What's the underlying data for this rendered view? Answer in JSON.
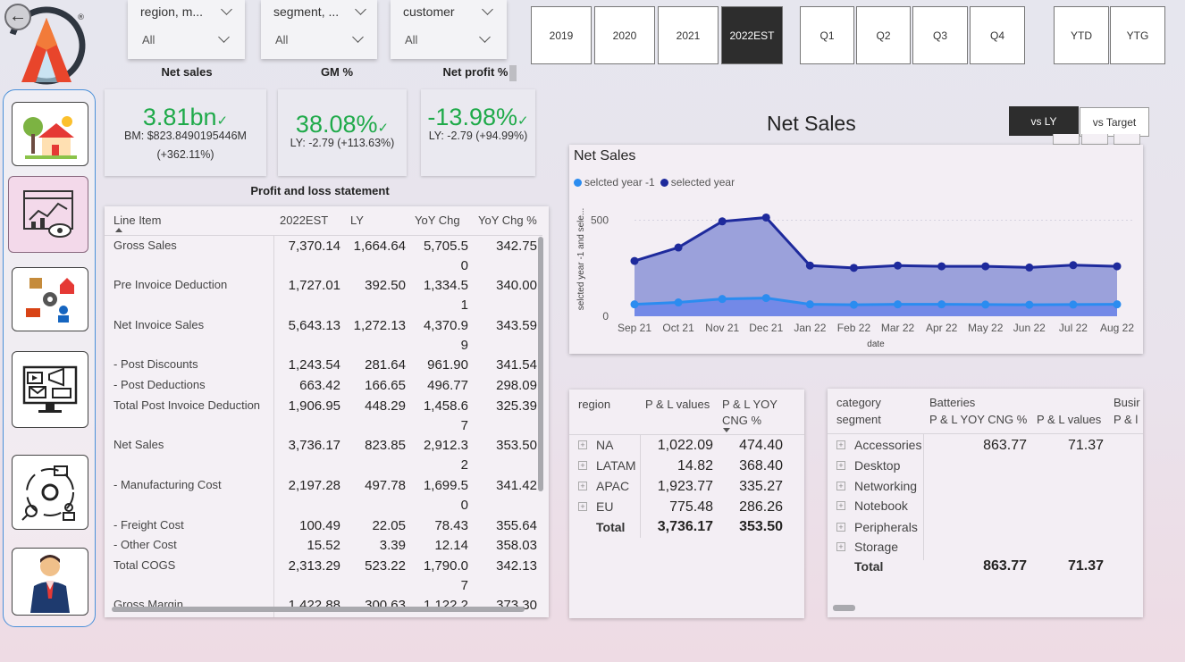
{
  "slicers": [
    {
      "title": "region, m...",
      "value": "All"
    },
    {
      "title": "segment, ...",
      "value": "All"
    },
    {
      "title": "customer",
      "value": "All"
    }
  ],
  "years": [
    "2019",
    "2020",
    "2021",
    "2022EST"
  ],
  "selected_year": "2022EST",
  "quarters": [
    "Q1",
    "Q2",
    "Q3",
    "Q4"
  ],
  "period_buttons": [
    "YTD",
    "YTG"
  ],
  "kpis": {
    "net_sales": {
      "title": "Net sales",
      "value": "3.81bn",
      "line1": "BM: $823.8490195446M",
      "line2": "(+362.11%)"
    },
    "gm": {
      "title": "GM %",
      "value": "38.08%",
      "line1": "LY: -2.79 (+113.63%)"
    },
    "net_profit": {
      "title": "Net profit %",
      "value": "-13.98%",
      "line1": "LY: -2.79 (+94.99%)"
    }
  },
  "pl": {
    "title": "Profit and loss statement",
    "headers": [
      "Line Item",
      "2022EST",
      "LY",
      "YoY Chg",
      "YoY Chg %"
    ],
    "rows": [
      {
        "label": "Gross Sales",
        "est": "7,370.14",
        "ly": "1,664.64",
        "chg1": "5,705.5",
        "chg2": "0",
        "pct": "342.75"
      },
      {
        "label": "Pre Invoice Deduction",
        "est": "1,727.01",
        "ly": "392.50",
        "chg1": "1,334.5",
        "chg2": "1",
        "pct": "340.00"
      },
      {
        "label": "Net Invoice Sales",
        "est": "5,643.13",
        "ly": "1,272.13",
        "chg1": "4,370.9",
        "chg2": "9",
        "pct": "343.59"
      },
      {
        "label": "- Post Discounts",
        "est": "1,243.54",
        "ly": "281.64",
        "chg1": "961.90",
        "chg2": "",
        "pct": "341.54"
      },
      {
        "label": "- Post Deductions",
        "est": "663.42",
        "ly": "166.65",
        "chg1": "496.77",
        "chg2": "",
        "pct": "298.09"
      },
      {
        "label": "Total Post Invoice Deduction",
        "est": "1,906.95",
        "ly": "448.29",
        "chg1": "1,458.6",
        "chg2": "7",
        "pct": "325.39"
      },
      {
        "label": "Net Sales",
        "est": "3,736.17",
        "ly": "823.85",
        "chg1": "2,912.3",
        "chg2": "2",
        "pct": "353.50"
      },
      {
        "label": "- Manufacturing Cost",
        "est": "2,197.28",
        "ly": "497.78",
        "chg1": "1,699.5",
        "chg2": "0",
        "pct": "341.42"
      },
      {
        "label": "- Freight Cost",
        "est": "100.49",
        "ly": "22.05",
        "chg1": "78.43",
        "chg2": "",
        "pct": "355.64"
      },
      {
        "label": "- Other Cost",
        "est": "15.52",
        "ly": "3.39",
        "chg1": "12.14",
        "chg2": "",
        "pct": "358.03"
      },
      {
        "label": "Total COGS",
        "est": "2,313.29",
        "ly": "523.22",
        "chg1": "1,790.0",
        "chg2": "7",
        "pct": "342.13"
      },
      {
        "label": "Gross Margin",
        "est": "1,422.88",
        "ly": "300.63",
        "chg1": "1,122.2",
        "chg2": "",
        "pct": "373.30"
      }
    ]
  },
  "toggle": {
    "vs_ly": "vs LY",
    "vs_target": "vs Target"
  },
  "net_sales_header": "Net Sales",
  "chart_data": {
    "type": "area",
    "title": "Net Sales",
    "xlabel": "date",
    "ylabel": "selcted year -1 and sele...",
    "x": [
      "Sep 21",
      "Oct 21",
      "Nov 21",
      "Dec 21",
      "Jan 22",
      "Feb 22",
      "Mar 22",
      "Apr 22",
      "May 22",
      "Jun 22",
      "Jul 22",
      "Aug 22"
    ],
    "series": [
      {
        "name": "selcted year -1",
        "color": "#2b8cf0",
        "values": [
          62,
          72,
          90,
          95,
          62,
          60,
          62,
          62,
          61,
          60,
          61,
          62
        ]
      },
      {
        "name": "selected year",
        "color": "#1e2a9c",
        "values": [
          288,
          358,
          494,
          514,
          264,
          252,
          264,
          260,
          260,
          254,
          266,
          260
        ]
      }
    ],
    "y_ticks": [
      "0",
      "500"
    ],
    "ylim": [
      0,
      600
    ],
    "legend": "top-left"
  },
  "region_table": {
    "headers": [
      "region",
      "P & L values",
      "P & L YOY",
      "CNG %"
    ],
    "rows": [
      {
        "name": "NA",
        "val": "1,022.09",
        "pct": "474.40"
      },
      {
        "name": "LATAM",
        "val": "14.82",
        "pct": "368.40"
      },
      {
        "name": "APAC",
        "val": "1,923.77",
        "pct": "335.27"
      },
      {
        "name": "EU",
        "val": "775.48",
        "pct": "286.26"
      }
    ],
    "total": {
      "label": "Total",
      "val": "3,736.17",
      "pct": "353.50"
    }
  },
  "cat_table": {
    "h_category": "category",
    "h_segment": "segment",
    "h_batteries": "Batteries",
    "h_busi": "Busir",
    "h_yoy": "P & L YOY CNG %",
    "h_vals": "P & L values",
    "h_pl": "P & l",
    "rows": [
      {
        "name": "Accessories",
        "yoy": "863.77",
        "val": "71.37"
      },
      {
        "name": "Desktop",
        "yoy": "",
        "val": ""
      },
      {
        "name": "Networking",
        "yoy": "",
        "val": ""
      },
      {
        "name": "Notebook",
        "yoy": "",
        "val": ""
      },
      {
        "name": "Peripherals",
        "yoy": "",
        "val": ""
      },
      {
        "name": "Storage",
        "yoy": "",
        "val": ""
      }
    ],
    "total": {
      "label": "Total",
      "yoy": "863.77",
      "val": "71.37"
    }
  },
  "colors": {
    "green": "#1faa4a",
    "dark": "#2d2d2d",
    "area": "#8b93d6"
  }
}
